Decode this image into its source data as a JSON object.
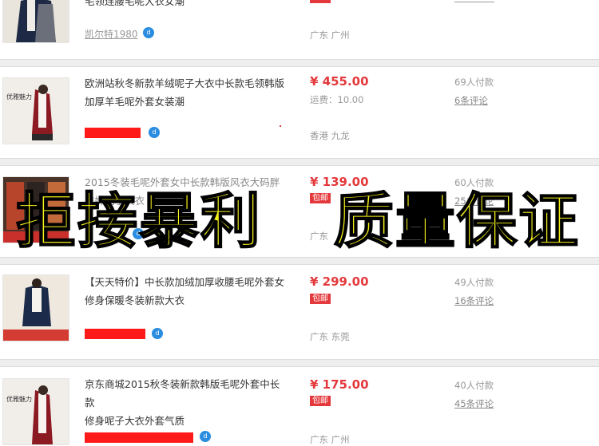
{
  "rows": [
    {
      "title": "毛领连腰毛呢大衣女潮",
      "seller": "凯尔特1980",
      "location": "广东 广州"
    },
    {
      "title_line1": "欧洲站秋冬新款羊绒呢子大衣中长款毛领韩版",
      "title_line2": "加厚羊毛呢外套女装潮",
      "price": "¥ 455.00",
      "shipping": "运费：10.00",
      "location": "香港 九龙",
      "buyers": "69人付款",
      "reviews": "6条评论",
      "thumb_label": "优雅魅力"
    },
    {
      "title_line1": "2015冬装毛呢外套女中长款韩版风衣大码胖",
      "title_line2": "妹妹呢子大衣",
      "price": "¥ 139.00",
      "badge": "包邮",
      "location": "广东",
      "buyers": "60人付款",
      "reviews": "25条评论"
    },
    {
      "title_line1": "【天天特价】中长款加绒加厚收腰毛呢外套女",
      "title_line2": "修身保暖冬装新款大衣",
      "price": "¥ 299.00",
      "badge": "包邮",
      "location": "广东 东莞",
      "buyers": "49人付款",
      "reviews": "16条评论"
    },
    {
      "title_line1": "京东商城2015秋冬装新款韩版毛呢外套中长款",
      "title_line2": "修身呢子大衣外套气质",
      "price": "¥ 175.00",
      "badge": "包邮",
      "location": "广东 广州",
      "buyers": "40人付款",
      "reviews": "45条评论",
      "thumb_label": "优雅魅力"
    }
  ],
  "overlay": {
    "left_text": "拒接暴利",
    "right_text": "质量保证"
  },
  "colors": {
    "price_red": "#e4393c",
    "overlay_yellow": "#f6f21a",
    "wangwang_blue": "#2a8de0"
  }
}
